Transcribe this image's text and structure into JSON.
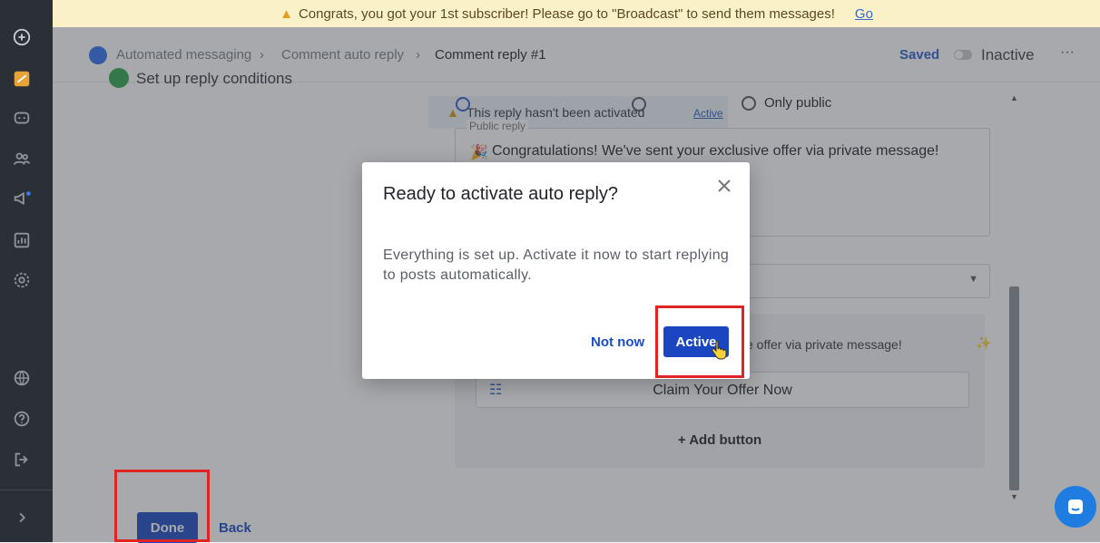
{
  "banner": {
    "message": "Congrats, you got your 1st subscriber! Please go to \"Broadcast\" to send them messages!",
    "link": "Go"
  },
  "header": {
    "breadcrumb": [
      "Automated messaging",
      "Comment auto reply",
      "Comment reply #1"
    ],
    "saved": "Saved",
    "status": "Inactive",
    "more": "···"
  },
  "content": {
    "section_title": "Set up reply conditions",
    "warning_text": "This reply hasn't been activated",
    "warning_action": "Active",
    "radio_option": "Only public",
    "public_reply_label": "Public reply",
    "public_reply_text": "Congratulations! We've sent your exclusive offer via private message!",
    "message_preview": "ve offer via private message!",
    "claim_button": "Claim Your Offer Now",
    "add_button": "+ Add button",
    "done_button": "Done",
    "back_button": "Back"
  },
  "modal": {
    "title": "Ready to activate auto reply?",
    "body": "Everything is set up. Activate it now to start replying to posts automatically.",
    "not_now": "Not now",
    "active": "Active"
  },
  "colors": {
    "primary": "#1a47c1",
    "highlight": "#e02424",
    "banner_bg": "#fbf1c9",
    "sidebar_bg": "#2b2f36"
  }
}
